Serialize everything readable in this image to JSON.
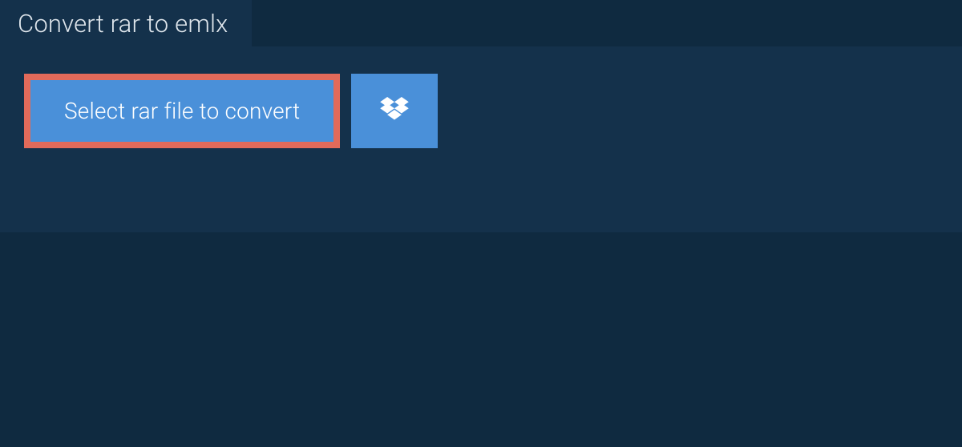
{
  "tab": {
    "title": "Convert rar to emlx"
  },
  "actions": {
    "select_label": "Select rar file to convert"
  },
  "colors": {
    "page_bg": "#0f2a40",
    "panel_bg": "#14314b",
    "button_bg": "#4a90d9",
    "highlight_border": "#e26a5a",
    "text_light": "#dfe6ec",
    "text_white": "#ffffff"
  }
}
